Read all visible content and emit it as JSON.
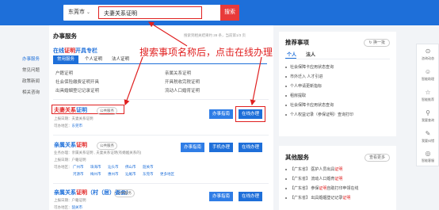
{
  "header": {
    "city": "东莞市",
    "query": "夫妻关系证明",
    "search_label": "搜索"
  },
  "leftnav": {
    "items": [
      "办事服务",
      "常见问题",
      "政策新闻",
      "相关咨询"
    ]
  },
  "main": {
    "title": "办事服务",
    "hint": "搜索到相关结果约 28 条，当前第1/3 页",
    "online_title_pre": "在线",
    "online_title_hl": "证明",
    "online_title_post": "开具专栏",
    "tabs": [
      "常用服务",
      "个人证明",
      "法人证明"
    ],
    "col1": [
      "户籍证明",
      "社会保险缴费证明开具",
      "出具婚姻登记记录证明"
    ],
    "col2": [
      "亲属关系证明",
      "开具税收完税证明",
      "流动人口婚育证明"
    ],
    "results": [
      {
        "title_hl": "夫妻关系",
        "title_post": "证明",
        "tag": "公共服务",
        "meta1_label": "上报日期：",
        "meta1_value": "夫妻关系证明",
        "meta2_label": "可办地区：",
        "meta2_value": "东莞市",
        "btn_guide": "办事指南",
        "btn_online": "在线办理"
      },
      {
        "title_pre": "亲属关系",
        "title_hl": "证明",
        "tag": "公共服务",
        "meta1_label": "业务办理：",
        "meta1_value": "亲属关系证明 , 夫妻关系证明(有婚姻关系的)",
        "meta2_label": "上报日期：",
        "meta2_value": "户籍证明",
        "meta3_label": "可办地区：",
        "areas_row1": [
          "广州市",
          "珠海市",
          "汕头市",
          "佛山市",
          "韶关市"
        ],
        "areas_row2": [
          "河源市",
          "梅州市",
          "惠州市",
          "汕尾市",
          "东莞市",
          "更多地区"
        ],
        "btn_guide": "办事指南",
        "btn_mobile": "手机办理",
        "btn_online": "在线办理"
      },
      {
        "title_pre": "亲属关系",
        "title_hl": "证明",
        "title_post": "（村（居）委会）",
        "tag": "公共服务",
        "meta1_label": "上报日期：",
        "meta1_value": "户籍证明",
        "meta2_label": "可办地区：",
        "meta2_value": "韶关市",
        "btn_guide": "办事指南",
        "btn_online": "在线办理"
      }
    ]
  },
  "recommend": {
    "title": "推荐事项",
    "refresh": "换一批",
    "tabs": [
      "个人",
      "法人"
    ],
    "items": [
      "社会保障卡应用状态查询",
      "市外迁入 人才引进",
      "个人申请更新指标",
      "租房提取",
      "社会保障卡应用状态查询",
      "个人权益记录（参保证明）查询打印"
    ]
  },
  "other": {
    "title": "其他服务",
    "more": "查看更多",
    "items": [
      {
        "pre": "【广东省】 医护人员出具",
        "hl": "证明",
        "post": ""
      },
      {
        "pre": "【广东省】 流动人口婚育",
        "hl": "证明",
        "post": ""
      },
      {
        "pre": "【广东省】 参保",
        "hl": "证明",
        "post": "自助打印申领在线"
      },
      {
        "pre": "【广东省】 出具婚姻登记记录",
        "hl": "证明",
        "post": ""
      }
    ]
  },
  "toolbar": {
    "items": [
      {
        "icon": "share-icon",
        "label": "咨询动态"
      },
      {
        "icon": "person-icon",
        "label": "智能助理"
      },
      {
        "icon": "star-icon",
        "label": "智能推荐"
      },
      {
        "icon": "search-icon",
        "label": "我要查询"
      },
      {
        "icon": "feedback-icon",
        "label": "我要纠错"
      },
      {
        "icon": "globe-icon",
        "label": "智能客服"
      }
    ]
  },
  "annotation": "搜索事项名称后，点击在线办理",
  "colors": {
    "brand": "#1e6fd9",
    "highlight": "#e02020",
    "search_button": "#e83a3a"
  }
}
